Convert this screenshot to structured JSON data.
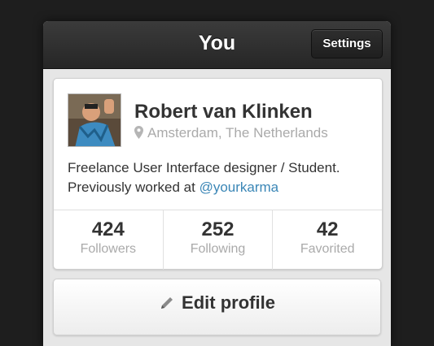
{
  "navbar": {
    "title": "You",
    "settings_label": "Settings"
  },
  "profile": {
    "name": "Robert van Klinken",
    "location": "Amsterdam, The Netherlands",
    "bio_line1": "Freelance User Interface designer / Student.",
    "bio_line2_prefix": "Previously worked at ",
    "bio_link": "@yourkarma",
    "avatar_icon": "user-avatar-photo"
  },
  "stats": [
    {
      "value": "424",
      "label": "Followers"
    },
    {
      "value": "252",
      "label": "Following"
    },
    {
      "value": "42",
      "label": "Favorited"
    }
  ],
  "actions": {
    "edit_label": "Edit profile",
    "edit_icon": "pencil-icon"
  },
  "colors": {
    "link": "#3a86b6",
    "navbar": "#2e2e2e",
    "muted": "#aaaaaa"
  }
}
